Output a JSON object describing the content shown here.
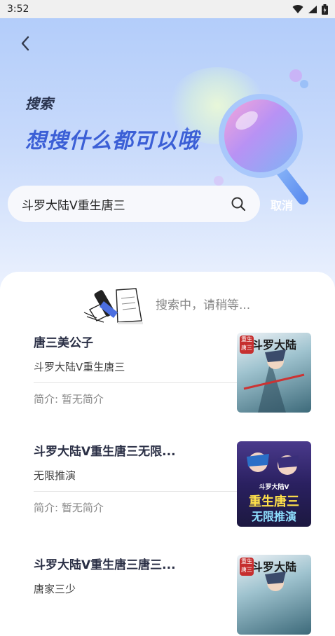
{
  "status_bar": {
    "time": "3:52"
  },
  "header": {
    "title_small": "搜索",
    "title_big": "想搜什么都可以哦",
    "search_value": "斗罗大陆V重生唐三",
    "cancel_label": "取消"
  },
  "loading": {
    "text": "搜索中，请稍等..."
  },
  "results": [
    {
      "title": "唐三美公子",
      "author": "斗罗大陆V重生唐三",
      "intro": "简介: 暂无简介"
    },
    {
      "title": "斗罗大陆V重生唐三无限...",
      "author": "无限推演",
      "intro": "简介: 暂无简介"
    },
    {
      "title": "斗罗大陆V重生唐三唐三...",
      "author": "唐家三少"
    }
  ],
  "covers": [
    {
      "label_main": "斗罗大陆",
      "label_badge": "重生唐三",
      "colors": [
        "#e9eef3",
        "#3d6a7a"
      ]
    },
    {
      "label_top": "斗罗大陆V",
      "label_main": "重生唐三",
      "label_sub": "无限推演",
      "colors": [
        "#3a2a6e",
        "#1c1840"
      ]
    },
    {
      "label_main": "斗罗大陆",
      "label_badge": "重生唐三",
      "colors": [
        "#e9eef3",
        "#3d6a7a"
      ]
    }
  ]
}
